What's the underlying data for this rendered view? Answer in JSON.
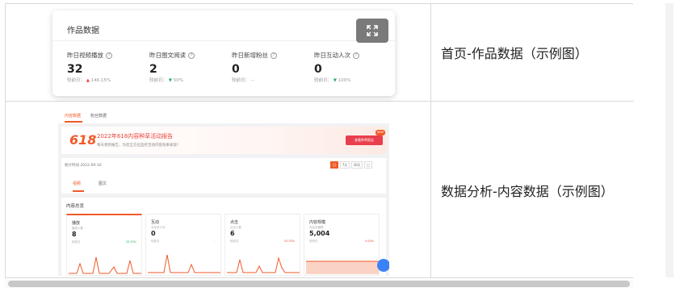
{
  "rows": [
    {
      "caption": "首页-作品数据（示例图）",
      "card": {
        "title": "作品数据",
        "metrics": [
          {
            "label": "昨日视频播放",
            "value": "32",
            "compare_prefix": "较前日：",
            "trend": "up",
            "compare_value": "146.15%"
          },
          {
            "label": "昨日图文阅读",
            "value": "2",
            "compare_prefix": "较前日：",
            "trend": "down",
            "compare_value": "50%"
          },
          {
            "label": "昨日新增粉丝",
            "value": "0",
            "compare_prefix": "较前日：",
            "trend": "none",
            "compare_value": "--"
          },
          {
            "label": "昨日互动人次",
            "value": "0",
            "compare_prefix": "较前日：",
            "trend": "down",
            "compare_value": "100%"
          }
        ]
      }
    },
    {
      "caption": "数据分析-内容数据（示例图）",
      "dashboard": {
        "tabs": [
          "内容数据",
          "粉丝数据"
        ],
        "banner": {
          "logo": "618",
          "title": "2022年618内容种草活动报告",
          "subtitle": "每天更新报告，为您全方位监控活动内容效果表现！",
          "button": "查看种草报告",
          "badge": "NEW"
        },
        "stat_time": "统计时间 2022-09-16",
        "ranges": [
          "日",
          "7天",
          "30天",
          "□"
        ],
        "sub_tabs": [
          "视频",
          "图文"
        ],
        "overview_title": "内容总览",
        "overview": [
          {
            "label": "播放",
            "sub": "播放人数",
            "value": "8",
            "compare": "较前日",
            "pct": "33.33%"
          },
          {
            "label": "互动",
            "sub": "互动总人次",
            "value": "0",
            "compare": "较前日",
            "pct": "--"
          },
          {
            "label": "点击",
            "sub": "点击人数",
            "value": "6",
            "compare": "较前日",
            "pct": "33.33%"
          },
          {
            "label": "内容规模",
            "sub": "内容总篇数",
            "value": "5,004",
            "compare": "较前日",
            "pct": "0.00%"
          }
        ]
      }
    }
  ],
  "colors": {
    "accent": "#f05a28",
    "up": "#e8453c",
    "down": "#27ae60",
    "border": "#d9d9d9"
  },
  "icons": {
    "expand": "expand-icon",
    "help": "question-circle-icon"
  }
}
